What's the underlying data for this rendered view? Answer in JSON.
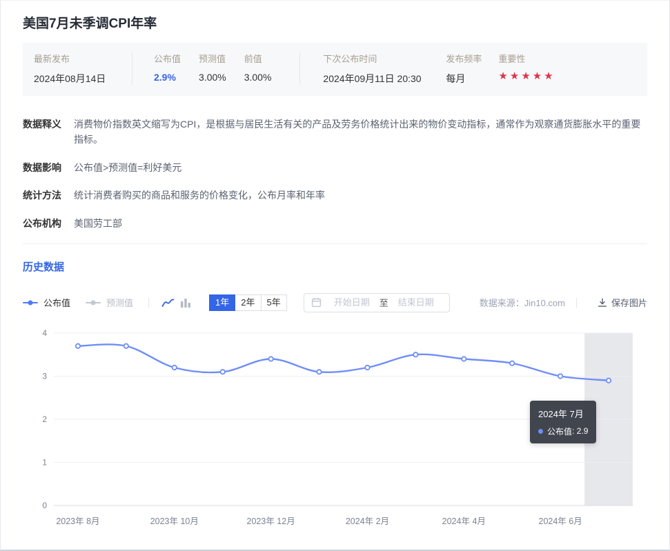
{
  "colors": {
    "accent": "#3465e6",
    "star": "#df3348",
    "line": "#6e8ef7",
    "band": "#e7e8ec"
  },
  "page": {
    "title": "美国7月未季调CPI年率"
  },
  "summary": {
    "latest_label": "最新发布",
    "latest_value": "2024年08月14日",
    "published_label": "公布值",
    "published_value": "2.9%",
    "forecast_label": "预测值",
    "forecast_value": "3.00%",
    "previous_label": "前值",
    "previous_value": "3.00%",
    "next_label": "下次公布时间",
    "next_value": "2024年09月11日 20:30",
    "frequency_label": "发布频率",
    "frequency_value": "每月",
    "importance_label": "重要性",
    "importance_stars": "★★★★★"
  },
  "details": [
    {
      "label": "数据释义",
      "text": "消费物价指数英文缩写为CPI，是根据与居民生活有关的产品及劳务价格统计出来的物价变动指标，通常作为观察通货膨胀水平的重要指标。"
    },
    {
      "label": "数据影响",
      "text": "公布值>预测值=利好美元"
    },
    {
      "label": "统计方法",
      "text": "统计消费者购买的商品和服务的价格变化，公布月率和年率"
    },
    {
      "label": "公布机构",
      "text": "美国劳工部"
    }
  ],
  "history": {
    "heading": "历史数据",
    "legend": [
      {
        "label": "公布值",
        "color": "#4d7bfe",
        "active": true
      },
      {
        "label": "预测值",
        "color": "#c3c8d2",
        "active": false
      }
    ],
    "range_buttons": [
      {
        "label": "1年",
        "active": true
      },
      {
        "label": "2年",
        "active": false
      },
      {
        "label": "5年",
        "active": false
      }
    ],
    "date_range": {
      "start_placeholder": "开始日期",
      "separator": "至",
      "end_placeholder": "结束日期"
    },
    "source_text": "数据来源：Jin10.com",
    "save_label": "保存图片"
  },
  "tooltip": {
    "title": "2024年 7月",
    "series_label": "公布值",
    "value": "2.9"
  },
  "chart_data": {
    "type": "line",
    "x": [
      "2023年8月",
      "2023年9月",
      "2023年10月",
      "2023年11月",
      "2023年12月",
      "2024年1月",
      "2024年2月",
      "2024年3月",
      "2024年4月",
      "2024年5月",
      "2024年6月",
      "2024年7月"
    ],
    "series": [
      {
        "name": "公布值",
        "values": [
          3.7,
          3.7,
          3.2,
          3.1,
          3.4,
          3.1,
          3.2,
          3.5,
          3.4,
          3.3,
          3.0,
          2.9
        ],
        "color": "#6e8ef7"
      }
    ],
    "x_tick_labels": [
      "2023年 8月",
      "2023年 10月",
      "2023年 12月",
      "2024年 2月",
      "2024年 4月",
      "2024年 6月"
    ],
    "x_tick_positions": [
      0,
      2,
      4,
      6,
      8,
      10
    ],
    "ylim": [
      0,
      4
    ],
    "y_ticks": [
      0,
      1,
      2,
      3,
      4
    ],
    "grid": true,
    "legend_position": "top-left",
    "highlight_index": 11
  }
}
